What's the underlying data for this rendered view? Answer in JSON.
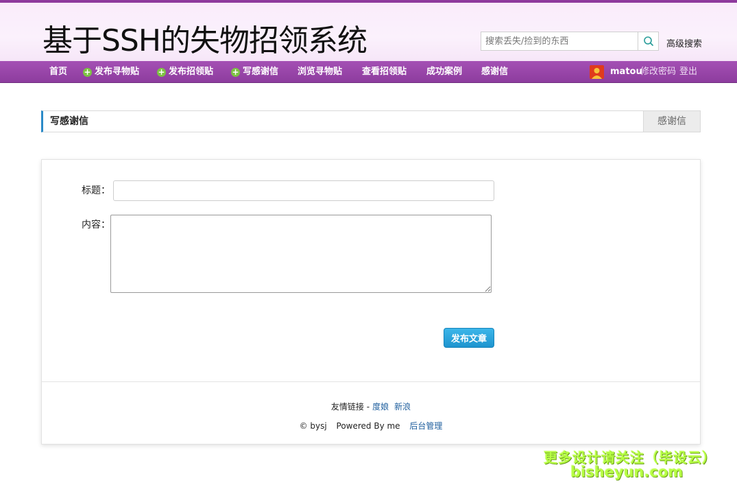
{
  "header": {
    "site_title": "基于SSH的失物招领系统",
    "search_placeholder": "搜索丢失/捡到的东西",
    "advanced_search": "高级搜索"
  },
  "nav": {
    "items": [
      {
        "label": "首页",
        "plus": false
      },
      {
        "label": "发布寻物贴",
        "plus": true
      },
      {
        "label": "发布招领贴",
        "plus": true
      },
      {
        "label": "写感谢信",
        "plus": true
      },
      {
        "label": "浏览寻物贴",
        "plus": false
      },
      {
        "label": "查看招领贴",
        "plus": false
      },
      {
        "label": "成功案例",
        "plus": false
      },
      {
        "label": "感谢信",
        "plus": false
      }
    ],
    "username": "matou",
    "change_password": "修改密码",
    "logout": "登出"
  },
  "section": {
    "title": "写感谢信",
    "tab": "感谢信"
  },
  "form": {
    "title_label": "标题：",
    "title_value": "",
    "content_label": "内容：",
    "content_value": "",
    "submit_label": "发布文章"
  },
  "footer": {
    "links_label": "友情链接 -",
    "links": [
      "度娘",
      "新浪"
    ],
    "copyright": "© bysj",
    "powered": "Powered By me",
    "admin_link": "后台管理"
  },
  "watermark": {
    "line1": "更多设计请关注（毕设云）",
    "line2": "bisheyun.com"
  },
  "colors": {
    "nav_purple": "#8d3c9e",
    "accent_blue": "#2a8ac8",
    "button_blue": "#1e94cf",
    "plus_green": "#7dc243"
  }
}
